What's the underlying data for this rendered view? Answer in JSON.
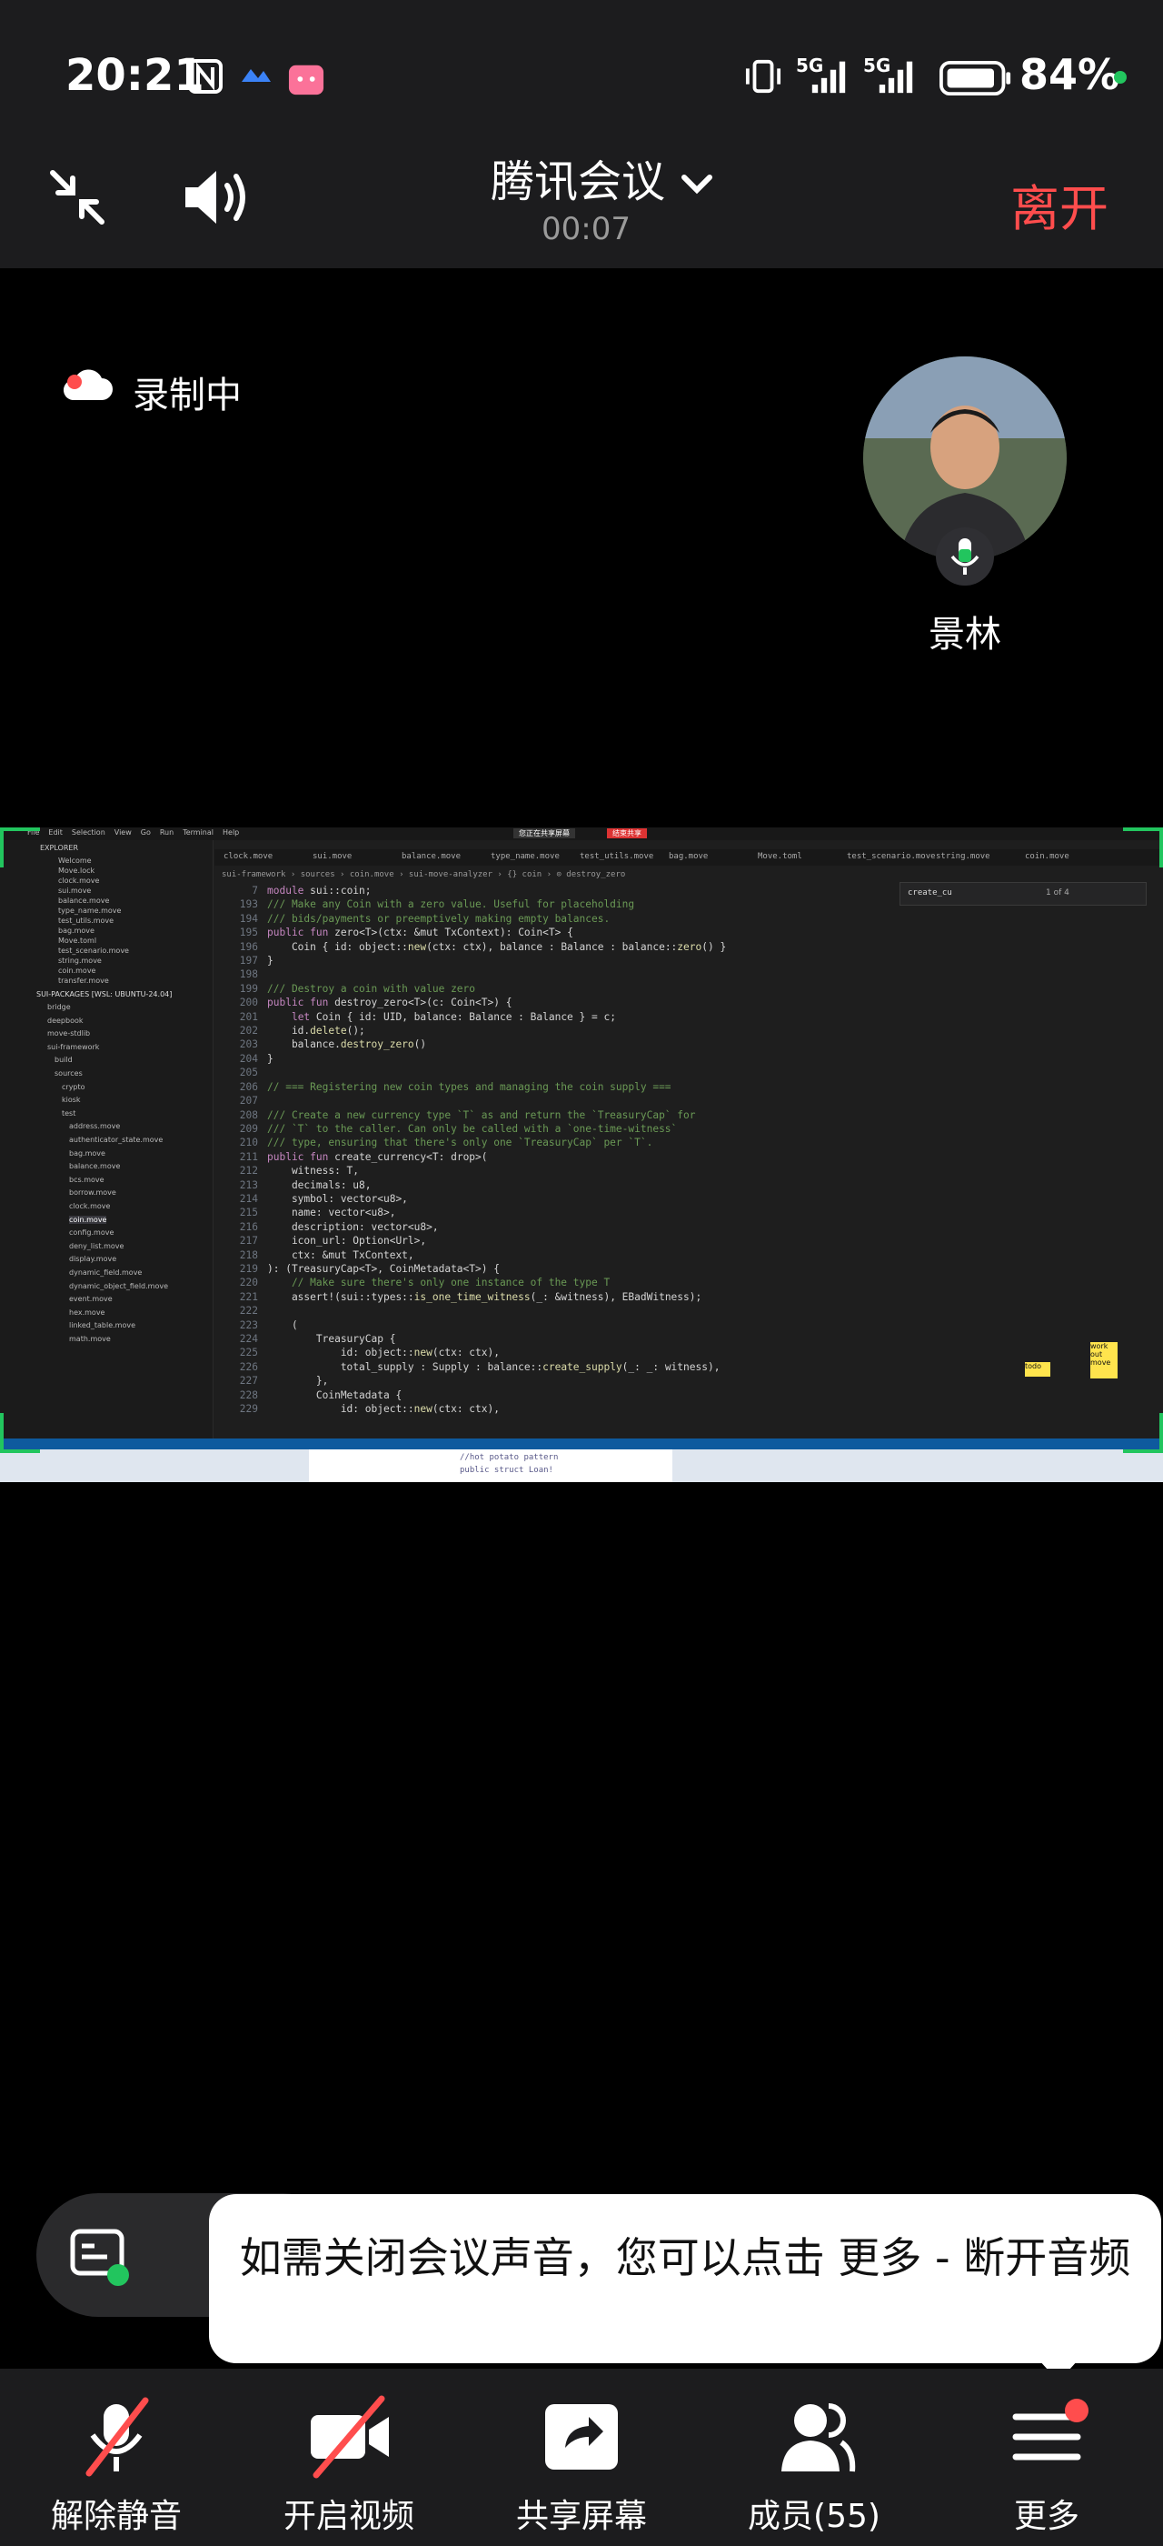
{
  "status_bar": {
    "time": "20:21",
    "network_1": "5G",
    "network_2": "5G",
    "battery": "84%"
  },
  "header": {
    "title": "腾讯会议",
    "timer": "00:07",
    "leave_label": "离开"
  },
  "recording": {
    "label": "录制中"
  },
  "speaker": {
    "name": "景林"
  },
  "shared_screen": {
    "menus": [
      "File",
      "Edit",
      "Selection",
      "View",
      "Go",
      "Run",
      "Terminal",
      "Help"
    ],
    "sharing_notice": "您正在共享屏幕",
    "stop_sharing": "结束共享",
    "tabs": [
      "clock.move",
      "sui.move",
      "balance.move",
      "type_name.move",
      "test_utils.move",
      "bag.move",
      "Move.toml",
      "test_scenario.move",
      "string.move",
      "coin.move"
    ],
    "breadcrumb": "sui-framework › sources › coin.move › sui-move-analyzer › {} coin › ⊙ destroy_zero",
    "find": {
      "query": "create_cu",
      "result": "1 of 4"
    },
    "explorer_title": "EXPLORER",
    "open_editors": [
      "Welcome",
      "Move.lock",
      "clock.move",
      "sui.move",
      "balance.move",
      "type_name.move",
      "test_utils.move",
      "bag.move",
      "Move.toml",
      "test_scenario.move",
      "string.move",
      "coin.move",
      "transfer.move"
    ],
    "packages_title": "SUI-PACKAGES [WSL: UBUNTU-24.04]",
    "packages": [
      "bridge",
      "deepbook",
      "move-stdlib",
      "sui-framework",
      "build",
      "sources",
      "crypto",
      "kiosk",
      "test",
      "address.move",
      "authenticator_state.move",
      "bag.move",
      "balance.move",
      "bcs.move",
      "borrow.move",
      "clock.move",
      "coin.move",
      "config.move",
      "deny_list.move",
      "display.move",
      "dynamic_field.move",
      "dynamic_object_field.move",
      "event.move",
      "hex.move",
      "linked_table.move",
      "math.move"
    ],
    "code": [
      {
        "n": "7",
        "t": "module sui::coin;",
        "c": "tx"
      },
      {
        "n": "193",
        "t": "/// Make any Coin with a zero value. Useful for placeholding",
        "c": "cm"
      },
      {
        "n": "194",
        "t": "/// bids/payments or preemptively making empty balances.",
        "c": "cm"
      },
      {
        "n": "195",
        "t": "public fun zero<T>(ctx: &mut TxContext): Coin<T> {",
        "c": "tx"
      },
      {
        "n": "196",
        "t": "    Coin { id: object::new(ctx: ctx), balance : Balance : balance::zero() }",
        "c": "tx"
      },
      {
        "n": "197",
        "t": "}",
        "c": "tx"
      },
      {
        "n": "198",
        "t": "",
        "c": "tx"
      },
      {
        "n": "199",
        "t": "/// Destroy a coin with value zero",
        "c": "cm"
      },
      {
        "n": "200",
        "t": "public fun destroy_zero<T>(c: Coin<T>) {",
        "c": "tx"
      },
      {
        "n": "201",
        "t": "    let Coin { id: UID, balance: Balance : Balance } = c;",
        "c": "tx"
      },
      {
        "n": "202",
        "t": "    id.delete();",
        "c": "tx"
      },
      {
        "n": "203",
        "t": "    balance.destroy_zero()",
        "c": "tx"
      },
      {
        "n": "204",
        "t": "}",
        "c": "tx"
      },
      {
        "n": "205",
        "t": "",
        "c": "tx"
      },
      {
        "n": "206",
        "t": "// === Registering new coin types and managing the coin supply ===",
        "c": "cm"
      },
      {
        "n": "207",
        "t": "",
        "c": "tx"
      },
      {
        "n": "208",
        "t": "/// Create a new currency type `T` as and return the `TreasuryCap` for",
        "c": "cm"
      },
      {
        "n": "209",
        "t": "/// `T` to the caller. Can only be called with a `one-time-witness`",
        "c": "cm"
      },
      {
        "n": "210",
        "t": "/// type, ensuring that there's only one `TreasuryCap` per `T`.",
        "c": "cm"
      },
      {
        "n": "211",
        "t": "public fun create_currency<T: drop>(",
        "c": "tx"
      },
      {
        "n": "212",
        "t": "    witness: T,",
        "c": "tx"
      },
      {
        "n": "213",
        "t": "    decimals: u8,",
        "c": "tx"
      },
      {
        "n": "214",
        "t": "    symbol: vector<u8>,",
        "c": "tx"
      },
      {
        "n": "215",
        "t": "    name: vector<u8>,",
        "c": "tx"
      },
      {
        "n": "216",
        "t": "    description: vector<u8>,",
        "c": "tx"
      },
      {
        "n": "217",
        "t": "    icon_url: Option<Url>,",
        "c": "tx"
      },
      {
        "n": "218",
        "t": "    ctx: &mut TxContext,",
        "c": "tx"
      },
      {
        "n": "219",
        "t": "): (TreasuryCap<T>, CoinMetadata<T>) {",
        "c": "tx"
      },
      {
        "n": "220",
        "t": "    // Make sure there's only one instance of the type T",
        "c": "cm"
      },
      {
        "n": "221",
        "t": "    assert!(sui::types::is_one_time_witness(_: &witness), EBadWitness);",
        "c": "tx"
      },
      {
        "n": "222",
        "t": "",
        "c": "tx"
      },
      {
        "n": "223",
        "t": "    (",
        "c": "tx"
      },
      {
        "n": "224",
        "t": "        TreasuryCap {",
        "c": "tx"
      },
      {
        "n": "225",
        "t": "            id: object::new(ctx: ctx),",
        "c": "tx"
      },
      {
        "n": "226",
        "t": "            total_supply : Supply : balance::create_supply(_: _: witness),",
        "c": "tx"
      },
      {
        "n": "227",
        "t": "        },",
        "c": "tx"
      },
      {
        "n": "228",
        "t": "        CoinMetadata {",
        "c": "tx"
      },
      {
        "n": "229",
        "t": "            id: object::new(ctx: ctx),",
        "c": "tx"
      }
    ],
    "sticky_notes": [
      "todo",
      "work out move"
    ],
    "taskbar_snippet": [
      "//hot potato pattern",
      "public struct Loan!"
    ]
  },
  "toast": {
    "text": "如需关闭会议声音，您可以点击 更多 - 断开音频"
  },
  "bottom_bar": {
    "unmute": "解除静音",
    "video": "开启视频",
    "share": "共享屏幕",
    "members": "成员(55)",
    "more": "更多"
  },
  "colors": {
    "leave": "#ff4d4d",
    "badge": "#ff4d4d",
    "screen_border": "#22c55e"
  }
}
